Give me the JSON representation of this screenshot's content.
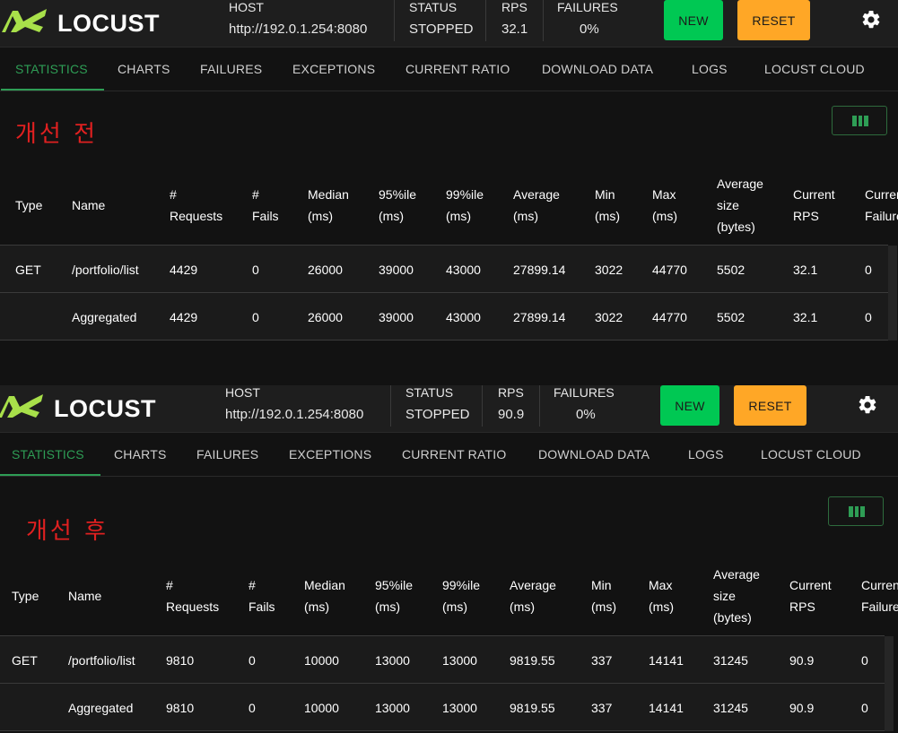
{
  "app": {
    "logo_text": "LOCUST",
    "colors": {
      "accent": "#2e9d55",
      "new_button": "#00c853",
      "reset_button": "#ffa726",
      "title_red": "#e02020"
    }
  },
  "stat_labels": {
    "host": "HOST",
    "status": "STATUS",
    "rps": "RPS",
    "failures": "FAILURES"
  },
  "buttons": {
    "new": "NEW",
    "reset": "RESET"
  },
  "tabs": [
    "STATISTICS",
    "CHARTS",
    "FAILURES",
    "EXCEPTIONS",
    "CURRENT RATIO",
    "DOWNLOAD DATA",
    "LOGS",
    "LOCUST CLOUD"
  ],
  "columns": [
    [
      "Type"
    ],
    [
      "Name"
    ],
    [
      "#",
      "Requests"
    ],
    [
      "#",
      "Fails"
    ],
    [
      "Median",
      "(ms)"
    ],
    [
      "95%ile",
      "(ms)"
    ],
    [
      "99%ile",
      "(ms)"
    ],
    [
      "Average",
      "(ms)"
    ],
    [
      "Min",
      "(ms)"
    ],
    [
      "Max",
      "(ms)"
    ],
    [
      "Average",
      "size",
      "(bytes)"
    ],
    [
      "Current",
      "RPS"
    ],
    [
      "Current",
      "Failures"
    ]
  ],
  "panels": [
    {
      "title": "개선 전",
      "host": "http://192.0.1.254:8080",
      "status": "STOPPED",
      "rps": "32.1",
      "failures": "0%",
      "rows": [
        [
          "GET",
          "/portfolio/list",
          "4429",
          "0",
          "26000",
          "39000",
          "43000",
          "27899.14",
          "3022",
          "44770",
          "5502",
          "32.1",
          "0"
        ],
        [
          "",
          "Aggregated",
          "4429",
          "0",
          "26000",
          "39000",
          "43000",
          "27899.14",
          "3022",
          "44770",
          "5502",
          "32.1",
          "0"
        ]
      ]
    },
    {
      "title": "개선 후",
      "host": "http://192.0.1.254:8080",
      "status": "STOPPED",
      "rps": "90.9",
      "failures": "0%",
      "rows": [
        [
          "GET",
          "/portfolio/list",
          "9810",
          "0",
          "10000",
          "13000",
          "13000",
          "9819.55",
          "337",
          "14141",
          "31245",
          "90.9",
          "0"
        ],
        [
          "",
          "Aggregated",
          "9810",
          "0",
          "10000",
          "13000",
          "13000",
          "9819.55",
          "337",
          "14141",
          "31245",
          "90.9",
          "0"
        ]
      ]
    }
  ]
}
